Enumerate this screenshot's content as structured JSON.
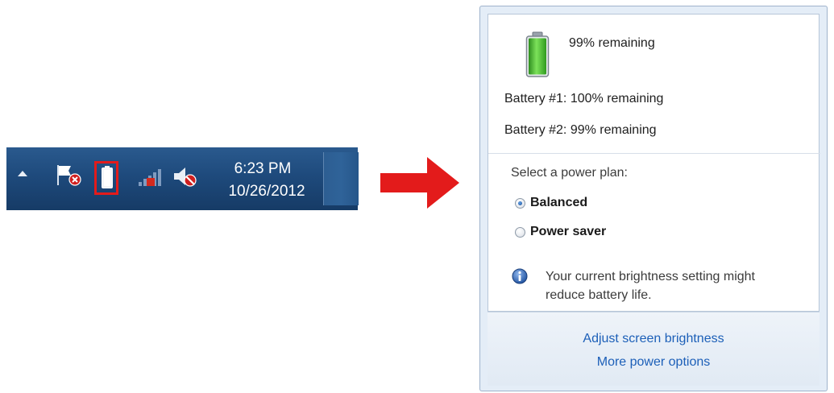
{
  "taskbar": {
    "time": "6:23 PM",
    "date": "10/26/2012",
    "icons": [
      "chevron-up-icon",
      "action-center-flag-icon",
      "battery-icon",
      "signal-icon",
      "volume-muted-icon"
    ]
  },
  "flyout": {
    "summary": "99% remaining",
    "battery1": "Battery #1: 100% remaining",
    "battery2": "Battery #2: 99% remaining",
    "battery_level": 0.99,
    "select_plan_label": "Select a power plan:",
    "plans": [
      {
        "label": "Balanced",
        "selected": true
      },
      {
        "label": "Power saver",
        "selected": false
      }
    ],
    "info_line1": "Your current brightness setting might",
    "info_line2": "reduce battery life.",
    "links": {
      "adjust_brightness": "Adjust screen brightness",
      "more_options": "More power options"
    }
  },
  "colors": {
    "highlight_box": "#e31b1b",
    "arrow": "#e31b1b",
    "link": "#1c5fb8",
    "battery_fill": "#3fbf2a"
  }
}
